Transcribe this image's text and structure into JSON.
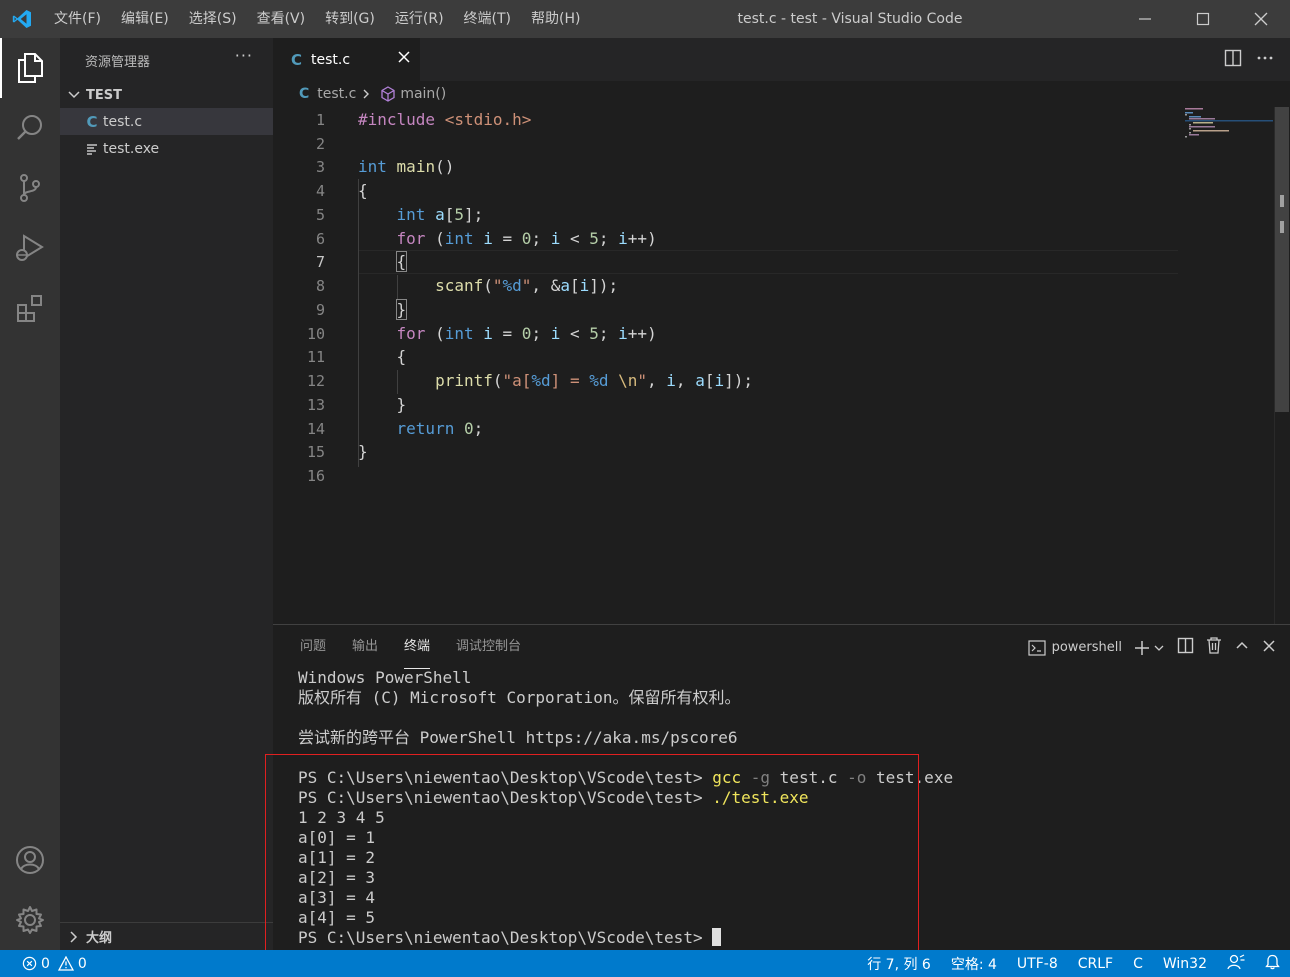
{
  "window": {
    "title": "test.c - test - Visual Studio Code",
    "menu": [
      "文件(F)",
      "编辑(E)",
      "选择(S)",
      "查看(V)",
      "转到(G)",
      "运行(R)",
      "终端(T)",
      "帮助(H)"
    ]
  },
  "sidebar": {
    "header": "资源管理器",
    "more": "···",
    "folder": "TEST",
    "files": [
      {
        "name": "test.c",
        "icon": "c-file-icon"
      },
      {
        "name": "test.exe",
        "icon": "exe-file-icon"
      }
    ],
    "outline": "大纲"
  },
  "tabs": [
    {
      "label": "test.c",
      "icon_glyph": "C"
    }
  ],
  "breadcrumb": {
    "icon_glyph": "C",
    "file": "test.c",
    "symbol": "main()"
  },
  "editor": {
    "line_numbers": [
      "1",
      "2",
      "3",
      "4",
      "5",
      "6",
      "7",
      "8",
      "9",
      "10",
      "11",
      "12",
      "13",
      "14",
      "15",
      "16"
    ],
    "current_line": 7,
    "code_lines": [
      "#include <stdio.h>",
      "",
      "int main()",
      "{",
      "    int a[5];",
      "    for (int i = 0; i < 5; i++)",
      "    {",
      "        scanf(\"%d\", &a[i]);",
      "    }",
      "    for (int i = 0; i < 5; i++)",
      "    {",
      "        printf(\"a[%d] = %d \\n\", i, a[i]);",
      "    }",
      "    return 0;",
      "}",
      ""
    ]
  },
  "panel": {
    "tabs": [
      "问题",
      "输出",
      "终端",
      "调试控制台"
    ],
    "active_tab": "终端",
    "shell": "powershell",
    "terminal": {
      "header_lines": [
        "Windows PowerShell",
        "版权所有 (C) Microsoft Corporation。保留所有权利。",
        "",
        "尝试新的跨平台 PowerShell https://aka.ms/pscore6",
        ""
      ],
      "prompt": "PS C:\\Users\\niewentao\\Desktop\\VScode\\test> ",
      "cmd1": {
        "exe": "gcc",
        "f1": "-g",
        "a1": "test.c",
        "f2": "-o",
        "a2": "test.exe"
      },
      "cmd2": "./test.exe",
      "output_lines": [
        "1 2 3 4 5",
        "a[0] = 1",
        "a[1] = 2",
        "a[2] = 3",
        "a[3] = 4",
        "a[4] = 5"
      ]
    }
  },
  "statusbar": {
    "errors": "0",
    "warnings": "0",
    "position": "行 7, 列 6",
    "spaces": "空格: 4",
    "encoding": "UTF-8",
    "eol": "CRLF",
    "language": "C",
    "platform": "Win32"
  },
  "colors": {
    "accent": "#007acc",
    "titlebar": "#3c3c3c",
    "activitybar": "#333333",
    "sidebar": "#252526",
    "editor": "#1e1e1e",
    "highlight_box": "#e02020"
  }
}
